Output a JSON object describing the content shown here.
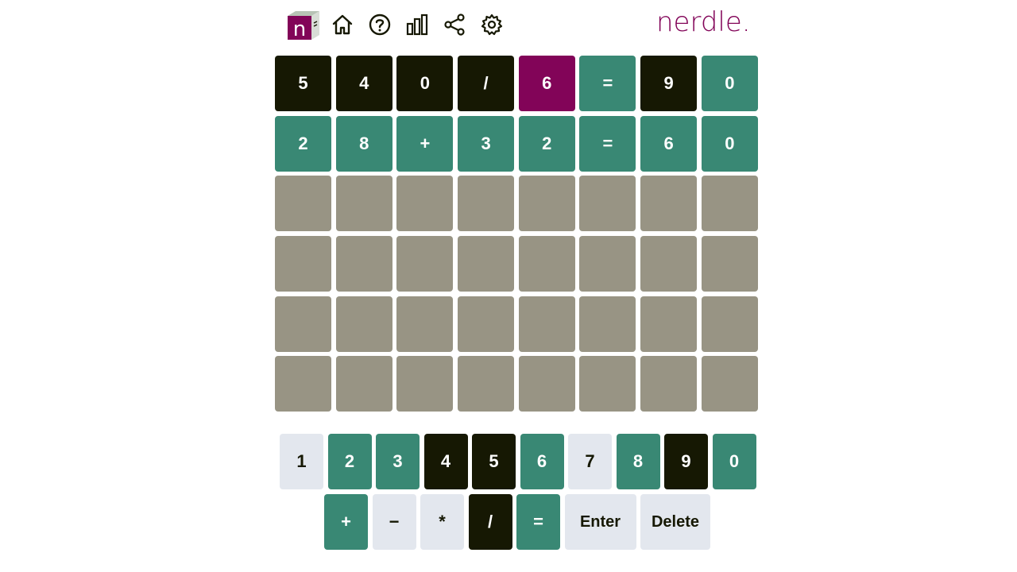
{
  "header": {
    "brand": "nerdle.",
    "icons": [
      "home-icon",
      "help-icon",
      "stats-icon",
      "share-icon",
      "settings-icon"
    ]
  },
  "colors": {
    "absent": "#161803",
    "correct": "#398874",
    "present": "#820458",
    "empty": "#989484",
    "unused_key": "#e3e7ee",
    "brand": "#820458"
  },
  "board": {
    "rows": [
      [
        {
          "v": "5",
          "s": "absent"
        },
        {
          "v": "4",
          "s": "absent"
        },
        {
          "v": "0",
          "s": "absent"
        },
        {
          "v": "/",
          "s": "absent"
        },
        {
          "v": "6",
          "s": "present"
        },
        {
          "v": "=",
          "s": "correct"
        },
        {
          "v": "9",
          "s": "absent"
        },
        {
          "v": "0",
          "s": "correct"
        }
      ],
      [
        {
          "v": "2",
          "s": "correct"
        },
        {
          "v": "8",
          "s": "correct"
        },
        {
          "v": "+",
          "s": "correct"
        },
        {
          "v": "3",
          "s": "correct"
        },
        {
          "v": "2",
          "s": "correct"
        },
        {
          "v": "=",
          "s": "correct"
        },
        {
          "v": "6",
          "s": "correct"
        },
        {
          "v": "0",
          "s": "correct"
        }
      ],
      [
        {
          "v": "",
          "s": "empty"
        },
        {
          "v": "",
          "s": "empty"
        },
        {
          "v": "",
          "s": "empty"
        },
        {
          "v": "",
          "s": "empty"
        },
        {
          "v": "",
          "s": "empty"
        },
        {
          "v": "",
          "s": "empty"
        },
        {
          "v": "",
          "s": "empty"
        },
        {
          "v": "",
          "s": "empty"
        }
      ],
      [
        {
          "v": "",
          "s": "empty"
        },
        {
          "v": "",
          "s": "empty"
        },
        {
          "v": "",
          "s": "empty"
        },
        {
          "v": "",
          "s": "empty"
        },
        {
          "v": "",
          "s": "empty"
        },
        {
          "v": "",
          "s": "empty"
        },
        {
          "v": "",
          "s": "empty"
        },
        {
          "v": "",
          "s": "empty"
        }
      ],
      [
        {
          "v": "",
          "s": "empty"
        },
        {
          "v": "",
          "s": "empty"
        },
        {
          "v": "",
          "s": "empty"
        },
        {
          "v": "",
          "s": "empty"
        },
        {
          "v": "",
          "s": "empty"
        },
        {
          "v": "",
          "s": "empty"
        },
        {
          "v": "",
          "s": "empty"
        },
        {
          "v": "",
          "s": "empty"
        }
      ],
      [
        {
          "v": "",
          "s": "empty"
        },
        {
          "v": "",
          "s": "empty"
        },
        {
          "v": "",
          "s": "empty"
        },
        {
          "v": "",
          "s": "empty"
        },
        {
          "v": "",
          "s": "empty"
        },
        {
          "v": "",
          "s": "empty"
        },
        {
          "v": "",
          "s": "empty"
        },
        {
          "v": "",
          "s": "empty"
        }
      ]
    ]
  },
  "keyboard": {
    "row1": [
      {
        "k": "1",
        "s": "unused"
      },
      {
        "k": "2",
        "s": "correct"
      },
      {
        "k": "3",
        "s": "correct"
      },
      {
        "k": "4",
        "s": "absent"
      },
      {
        "k": "5",
        "s": "absent"
      },
      {
        "k": "6",
        "s": "correct"
      },
      {
        "k": "7",
        "s": "unused"
      },
      {
        "k": "8",
        "s": "correct"
      },
      {
        "k": "9",
        "s": "absent"
      },
      {
        "k": "0",
        "s": "correct"
      }
    ],
    "row2": [
      {
        "k": "+",
        "s": "correct"
      },
      {
        "k": "−",
        "s": "unused"
      },
      {
        "k": "*",
        "s": "unused"
      },
      {
        "k": "/",
        "s": "absent"
      },
      {
        "k": "=",
        "s": "correct"
      },
      {
        "k": "Enter",
        "s": "unused"
      },
      {
        "k": "Delete",
        "s": "unused"
      }
    ]
  }
}
